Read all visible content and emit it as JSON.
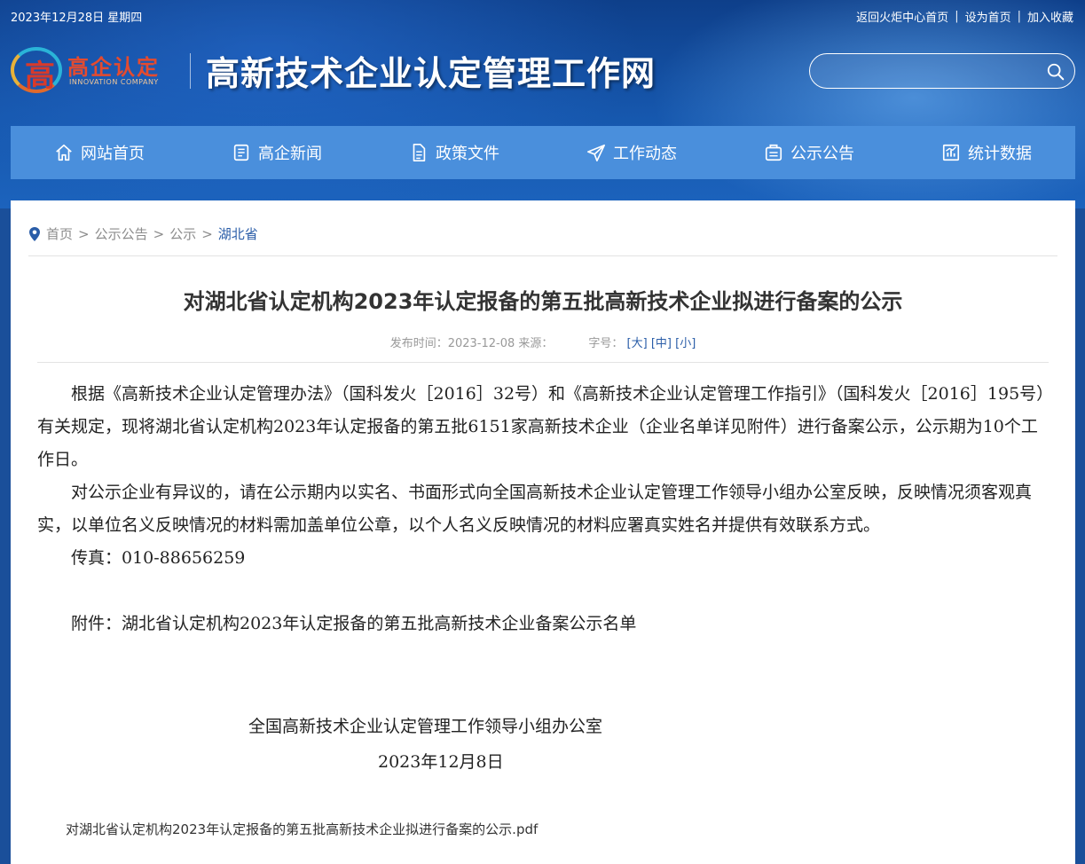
{
  "topbar": {
    "date": "2023年12月28日 星期四",
    "links": [
      "返回火炬中心首页",
      "设为首页",
      "加入收藏"
    ],
    "separator": "|"
  },
  "logo": {
    "glyph": "高",
    "cn": "高企认定",
    "en": "INNOVATION COMPANY"
  },
  "site_title": "高新技术企业认定管理工作网",
  "search": {
    "placeholder": "",
    "icon": "search-icon"
  },
  "nav": [
    {
      "label": "网站首页",
      "icon": "home-icon"
    },
    {
      "label": "高企新闻",
      "icon": "news-icon"
    },
    {
      "label": "政策文件",
      "icon": "document-icon"
    },
    {
      "label": "工作动态",
      "icon": "send-icon"
    },
    {
      "label": "公示公告",
      "icon": "notice-icon"
    },
    {
      "label": "统计数据",
      "icon": "chart-icon"
    }
  ],
  "breadcrumb": {
    "items": [
      "首页",
      "公示公告",
      "公示",
      "湖北省"
    ],
    "separator": ">"
  },
  "article": {
    "title": "对湖北省认定机构2023年认定报备的第五批高新技术企业拟进行备案的公示",
    "meta_publish": "发布时间：2023-12-08 来源：",
    "meta_size_label": "字号：",
    "size_large": "[大]",
    "size_medium": "[中]",
    "size_small": "[小]",
    "paragraphs": [
      "根据《高新技术企业认定管理办法》（国科发火［2016］32号）和《高新技术企业认定管理工作指引》（国科发火［2016］195号）有关规定，现将湖北省认定机构2023年认定报备的第五批6151家高新技术企业（企业名单详见附件）进行备案公示，公示期为10个工作日。",
      "对公示企业有异议的，请在公示期内以实名、书面形式向全国高新技术企业认定管理工作领导小组办公室反映，反映情况须客观真实，以单位名义反映情况的材料需加盖单位公章，以个人名义反映情况的材料应署真实姓名并提供有效联系方式。",
      "传真：010-88656259",
      "附件：湖北省认定机构2023年认定报备的第五批高新技术企业备案公示名单"
    ],
    "signature": "全国高新技术企业认定管理工作领导小组办公室",
    "sign_date": "2023年12月8日",
    "attachment": "对湖北省认定机构2023年认定报备的第五批高新技术企业拟进行备案的公示.pdf"
  },
  "colors": {
    "nav_bg": "#4a8fdc",
    "link_blue": "#2a5da8",
    "header_dark": "#0e3f8a"
  }
}
